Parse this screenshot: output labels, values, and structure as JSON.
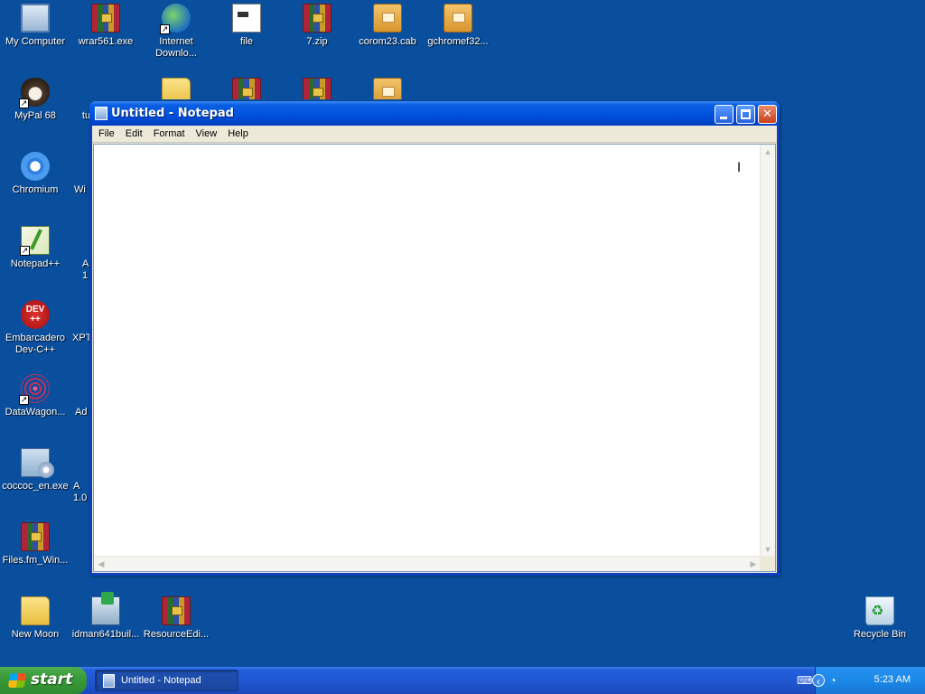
{
  "desktop": {
    "icons": [
      {
        "label": "My Computer"
      },
      {
        "label": "wrar561.exe"
      },
      {
        "label": "Internet\nDownlo..."
      },
      {
        "label": "file"
      },
      {
        "label": "7.zip"
      },
      {
        "label": "corom23.cab"
      },
      {
        "label": "gchromef32..."
      },
      {
        "label": "MyPal 68"
      },
      {
        "label": "tu"
      },
      {
        "label": "Chromium"
      },
      {
        "label": "Wi"
      },
      {
        "label": "Notepad++"
      },
      {
        "label": "A\n1"
      },
      {
        "label": "Embarcadero\nDev-C++"
      },
      {
        "label": "XPT"
      },
      {
        "label": "DataWagon..."
      },
      {
        "label": "Ad"
      },
      {
        "label": "coccoc_en.exe"
      },
      {
        "label": "A\n1.0"
      },
      {
        "label": "Files.fm_Win..."
      },
      {
        "label": "New Moon"
      },
      {
        "label": "idman641buil..."
      },
      {
        "label": "ResourceEdi..."
      },
      {
        "label": "Recycle Bin"
      }
    ],
    "dev_badge": "DEV\n++"
  },
  "notepad": {
    "title": "Untitled - Notepad",
    "menu": [
      "File",
      "Edit",
      "Format",
      "View",
      "Help"
    ],
    "content": "",
    "cursor_glyph": "I"
  },
  "taskbar": {
    "start_label": "start",
    "task_label": "Untitled - Notepad",
    "clock": "5:23 AM"
  },
  "colors": {
    "desktop_bg": "#0a4f9e",
    "titlebar": "#0050dc",
    "taskbar": "#245edb",
    "start": "#3a9a3a"
  }
}
